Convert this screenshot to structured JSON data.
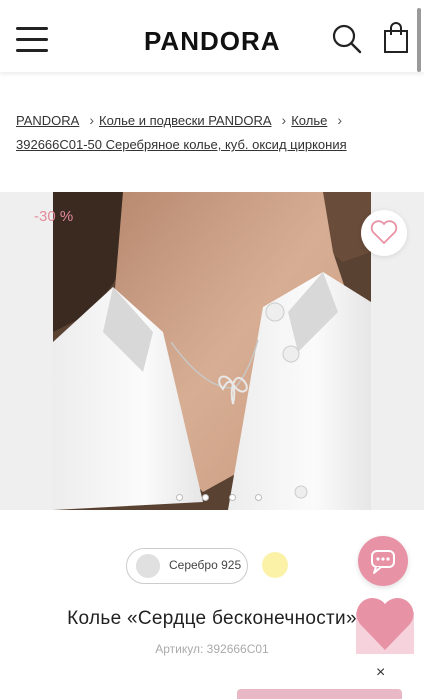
{
  "header": {
    "logo": "PANDORA",
    "menu_icon": "hamburger-menu-icon",
    "search_icon": "search-icon",
    "bag_icon": "shopping-bag-icon"
  },
  "breadcrumb": [
    {
      "label": "PANDORA"
    },
    {
      "label": "Колье и подвески PANDORA"
    },
    {
      "label": "Колье"
    },
    {
      "label": "392666C01-50 Серебряное колье, куб. оксид циркония"
    }
  ],
  "product": {
    "discount": "-30 %",
    "image_dots_count": 4,
    "variant_label": "Серебро 925",
    "title": "Колье «Сердце бесконечности»",
    "article": "Артикул: 392666C01"
  },
  "colors": {
    "accent_pink": "#e892a6",
    "discount_text": "#e58a9a",
    "silver_swatch": "#e0e0e0",
    "gold_swatch": "#fbf2a8"
  },
  "widgets": {
    "chat_icon": "chat-bubble-icon",
    "heart_icon": "heart-icon",
    "close_icon": "close-icon",
    "close_symbol": "×"
  }
}
